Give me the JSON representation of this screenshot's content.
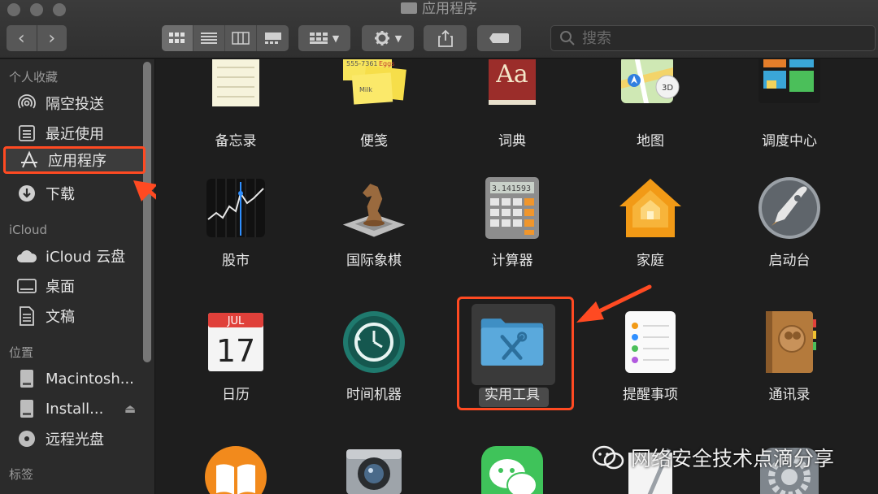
{
  "window": {
    "title": "应用程序"
  },
  "toolbar": {
    "back_symbol": "‹",
    "forward_symbol": "›",
    "search_placeholder": "搜索",
    "search_value": ""
  },
  "sidebar": {
    "sections": [
      {
        "title": "个人收藏"
      },
      {
        "title": "iCloud"
      },
      {
        "title": "位置"
      },
      {
        "title": "标签"
      }
    ],
    "items": [
      {
        "label": "隔空投送",
        "icon": "airdrop-icon"
      },
      {
        "label": "最近使用",
        "icon": "recents-icon"
      },
      {
        "label": "应用程序",
        "icon": "applications-icon",
        "selected": true
      },
      {
        "label": "下载",
        "icon": "downloads-icon"
      },
      {
        "label": "iCloud 云盘",
        "icon": "icloud-icon"
      },
      {
        "label": "桌面",
        "icon": "desktop-icon"
      },
      {
        "label": "文稿",
        "icon": "documents-icon"
      },
      {
        "label": "Macintosh...",
        "icon": "disk-icon"
      },
      {
        "label": "Install...",
        "icon": "disk-icon",
        "eject": "⏏"
      },
      {
        "label": "远程光盘",
        "icon": "cd-icon"
      }
    ]
  },
  "apps": [
    {
      "label": "备忘录",
      "icon": "notes-app-icon"
    },
    {
      "label": "便笺",
      "icon": "stickies-app-icon"
    },
    {
      "label": "词典",
      "icon": "dictionary-app-icon",
      "glyph": "Aa"
    },
    {
      "label": "地图",
      "icon": "maps-app-icon",
      "glyph": "3D"
    },
    {
      "label": "调度中心",
      "icon": "mission-control-app-icon"
    },
    {
      "label": "股市",
      "icon": "stocks-app-icon"
    },
    {
      "label": "国际象棋",
      "icon": "chess-app-icon"
    },
    {
      "label": "计算器",
      "icon": "calculator-app-icon",
      "glyph": "3.141593"
    },
    {
      "label": "家庭",
      "icon": "home-app-icon"
    },
    {
      "label": "启动台",
      "icon": "launchpad-app-icon"
    },
    {
      "label": "日历",
      "icon": "calendar-app-icon",
      "month": "JUL",
      "day": "17"
    },
    {
      "label": "时间机器",
      "icon": "time-machine-app-icon"
    },
    {
      "label": "实用工具",
      "icon": "utilities-folder-icon",
      "selected": true
    },
    {
      "label": "提醒事项",
      "icon": "reminders-app-icon"
    },
    {
      "label": "通讯录",
      "icon": "contacts-app-icon"
    },
    {
      "label": "",
      "icon": "books-app-icon"
    },
    {
      "label": "",
      "icon": "image-capture-app-icon"
    },
    {
      "label": "",
      "icon": "wechat-app-icon"
    },
    {
      "label": "",
      "icon": "textedit-app-icon"
    },
    {
      "label": "",
      "icon": "system-preferences-app-icon"
    }
  ],
  "stickies_notes": [
    "555-7361",
    "Eggs",
    "Milk"
  ],
  "watermark": "网络安全技术点滴分享",
  "colors": {
    "highlight": "#ff4a22",
    "folder": "#5aa9dc"
  }
}
